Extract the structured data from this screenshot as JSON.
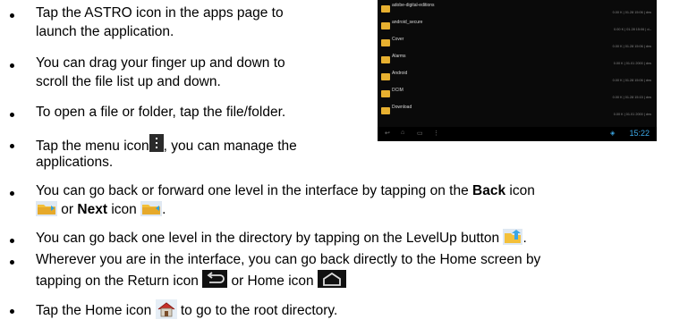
{
  "bullets": [
    {
      "lines": [
        "Tap the ASTRO icon in the apps page to",
        "launch the application."
      ]
    },
    {
      "lines": [
        "You can drag your finger up and down to",
        "scroll the file list up and down."
      ]
    },
    {
      "lines": [
        "To open a file or folder, tap the file/folder."
      ]
    },
    {
      "line1_pre": "Tap the menu icon",
      "line1_post": ", you can manage the",
      "line2": "applications."
    },
    {
      "pre": "You can go back or forward one level in the interface by tapping on the ",
      "back_bold": "Back",
      "post": " icon",
      "or_text": " or ",
      "next_bold": "Next",
      "next_post": " icon ",
      "end": "."
    },
    {
      "pre": "You can go back one level in the directory by tapping on the LevelUp button ",
      "end": "."
    },
    {
      "line1": "Wherever you are in the interface, you can go back directly to the Home screen by",
      "line2_pre": "tapping on the Return icon ",
      "line2_mid": " or Home icon "
    },
    {
      "pre": "Tap the Home icon ",
      "post": " to go to the root directory."
    }
  ],
  "screenshot": {
    "files": [
      {
        "name": "adobe-digital-editions",
        "date": "0.00 K | 01.28 15:06 | drw"
      },
      {
        "name": "android_secure",
        "date": "0.00 K | 01.28 15:06 | d--"
      },
      {
        "name": "Cover",
        "date": "0.00 K | 01.28 15:06 | drw"
      },
      {
        "name": "Alarms",
        "date": "0.00 K | 01.01 2000 | drw"
      },
      {
        "name": "Android",
        "date": "0.00 K | 01.28 15:06 | drw"
      },
      {
        "name": "DCIM",
        "date": "0.00 K | 01.28 15:15 | drw"
      },
      {
        "name": "Download",
        "date": "0.00 K | 01.01 2000 | drw"
      }
    ],
    "time": "15:22"
  },
  "icons": [
    "menu-icon",
    "back-folder-icon",
    "next-folder-icon",
    "levelup-folder-icon",
    "return-icon",
    "home-screen-icon",
    "home-directory-icon"
  ]
}
